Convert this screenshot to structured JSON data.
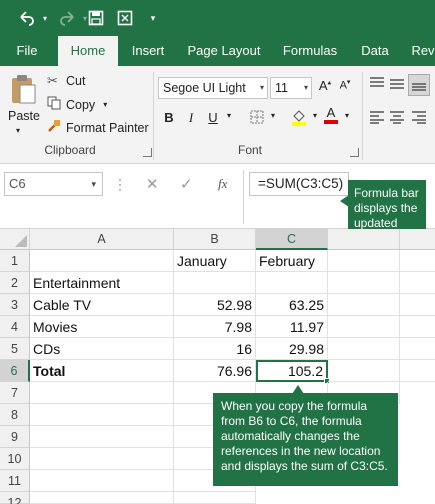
{
  "colors": {
    "accent": "#217346",
    "ribbon_bg": "#f3f3f3",
    "callout_bg": "#217346"
  },
  "quick_access": [
    {
      "icon": "undo-icon"
    },
    {
      "icon": "redo-icon"
    },
    {
      "icon": "save-icon"
    },
    {
      "icon": "touch-mode-icon"
    },
    {
      "icon": "customize-chevron-icon"
    }
  ],
  "tabs": [
    {
      "label": "File"
    },
    {
      "label": "Home"
    },
    {
      "label": "Insert"
    },
    {
      "label": "Page Layout"
    },
    {
      "label": "Formulas"
    },
    {
      "label": "Data"
    },
    {
      "label": "Rev"
    }
  ],
  "clipboard": {
    "paste": "Paste",
    "cut": "Cut",
    "copy": "Copy",
    "format_painter": "Format Painter",
    "group_label": "Clipboard"
  },
  "font": {
    "family": "Segoe UI Light",
    "size": "11",
    "group_label": "Font"
  },
  "formula_bar": {
    "name_box": "C6",
    "fx": "fx",
    "formula": "=SUM(C3:C5)"
  },
  "callouts": {
    "formula_bar": "Formula bar displays the updated formula.",
    "copy_note": "When you copy the formula from B6 to C6, the formula automatically changes the references in the new location and displays the sum of C3:C5."
  },
  "sheet": {
    "columns": [
      "A",
      "B",
      "C"
    ],
    "rows": [
      "1",
      "2",
      "3",
      "4",
      "5",
      "6",
      "7",
      "8",
      "9",
      "10",
      "11",
      "12"
    ],
    "r1": {
      "b": "January",
      "c": "February"
    },
    "r2": {
      "a": "Entertainment"
    },
    "r3": {
      "a": "Cable TV",
      "b": "52.98",
      "c": "63.25"
    },
    "r4": {
      "a": "Movies",
      "b": "7.98",
      "c": "11.97"
    },
    "r5": {
      "a": "CDs",
      "b": "16",
      "c": "29.98"
    },
    "r6": {
      "a": "Total",
      "b": "76.96",
      "c": "105.2"
    }
  }
}
